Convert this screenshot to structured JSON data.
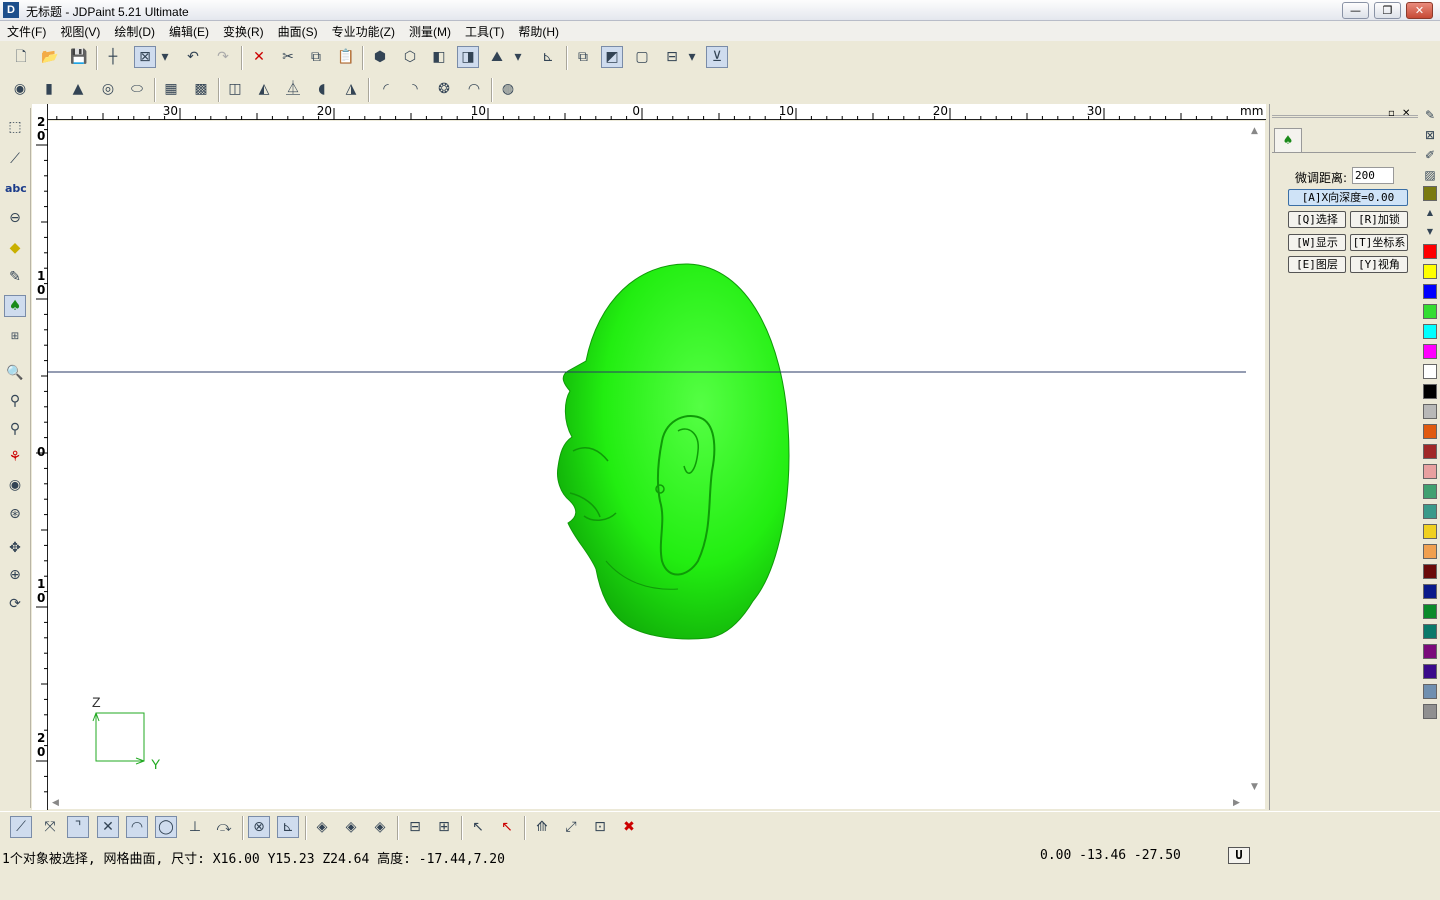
{
  "window": {
    "title": "无标题 - JDPaint 5.21 Ultimate",
    "icon_letter": "D",
    "minimize": "—",
    "maximize": "❐",
    "close": "✕"
  },
  "menu": [
    "文件(F)",
    "视图(V)",
    "绘制(D)",
    "编辑(E)",
    "变换(R)",
    "曲面(S)",
    "专业功能(Z)",
    "测量(M)",
    "工具(T)",
    "帮助(H)"
  ],
  "ruler": {
    "unit": "mm",
    "h_labels": [
      "30",
      "20",
      "10",
      "0",
      "10",
      "20",
      "30"
    ],
    "v_labels": [
      [
        "2",
        "0"
      ],
      [
        "1",
        "0"
      ],
      [
        "0"
      ],
      [
        "1",
        "0"
      ],
      [
        "2",
        "0"
      ]
    ]
  },
  "axis_indicator": {
    "z": "Z",
    "y": "Y"
  },
  "right_panel": {
    "fine_label": "微调距离:",
    "fine_value": "200",
    "depth_button": "[A]X向深度=0.00",
    "buttons": [
      "[Q]选择",
      "[R]加锁",
      "[W]显示",
      "[T]坐标系",
      "[E]图层",
      "[Y]视角"
    ]
  },
  "palette": [
    "#ff0000",
    "#ffff00",
    "#0000ff",
    "#33dd33",
    "#00ffff",
    "#ff00ff",
    "#ffffff",
    "#000000",
    "#b8b8b8",
    "#e05a10",
    "#a02828",
    "#e8a0a0",
    "#40a070",
    "#3a9a8a",
    "#f0d020",
    "#f0a050",
    "#6a0a0a",
    "#0a1a8a",
    "#0a8a2a",
    "#0a7a6a",
    "#7a0a7a",
    "#3a0a8a",
    "#7090b0",
    "#909090"
  ],
  "status": {
    "message": "1个对象被选择, 网格曲面, 尺寸: X16.00 Y15.23 Z24.64 高度: -17.44,7.20",
    "coords": "0.00 -13.46 -27.50",
    "unit_button": "U"
  },
  "colors": {
    "model": "#22ee11",
    "model_dark": "#0f9a08",
    "crosshair": "#2a3a66",
    "axis": "#22aa22"
  }
}
